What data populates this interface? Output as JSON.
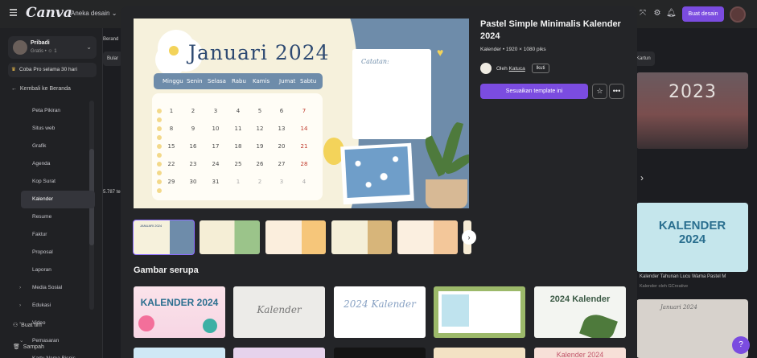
{
  "topbar": {
    "logo": "Canva",
    "menu": "Aneka desain",
    "create_button": "Buat desain"
  },
  "sidebar": {
    "account_name": "Pribadi",
    "account_sub": "Gratis • ☺ 1",
    "pro_label": "Coba Pro selama 30 hari",
    "back_label": "Kembali ke Beranda",
    "items": [
      {
        "label": "Peta Pikiran"
      },
      {
        "label": "Situs web"
      },
      {
        "label": "Grafik"
      },
      {
        "label": "Agenda"
      },
      {
        "label": "Kop Surat"
      },
      {
        "label": "Kalender"
      },
      {
        "label": "Resume"
      },
      {
        "label": "Faktur"
      },
      {
        "label": "Proposal"
      },
      {
        "label": "Laporan"
      },
      {
        "label": "Media Sosial"
      },
      {
        "label": "Edukasi"
      },
      {
        "label": "Video"
      },
      {
        "label": "Pemasaran"
      },
      {
        "label": "Kartu Nama Bisnis"
      }
    ],
    "create_team": "Buat tim",
    "trash": "Sampah"
  },
  "background": {
    "breadcrumb": "Berand",
    "tab_left": "Bular",
    "tab_right": "Kartun",
    "left_count": "5.787 te",
    "right_year": "2023",
    "right_card_title": "KALENDER 2024",
    "right_caption": "Kalender Tahunan Lucu Warna Pastel M",
    "right_caption_sub": "Kalender oleh GCreative",
    "card3_title": "Januari 2024"
  },
  "modal": {
    "title": "Pastel Simple Minimalis Kalender 2024",
    "meta": "Kalender • 1920 × 1080 piks",
    "author_prefix": "Oleh",
    "author": "Katuca",
    "follow": "Ikuti",
    "use_button": "Sesuaikan template ini",
    "similar_title": "Gambar serupa"
  },
  "preview": {
    "month": "Januari 2024",
    "days": [
      "Minggu",
      "Senin",
      "Selasa",
      "Rabu",
      "Kamis",
      "Jumat",
      "Sabtu"
    ],
    "notes_label": "Catatan:",
    "weeks": [
      [
        "1",
        "2",
        "3",
        "4",
        "5",
        "6",
        "7"
      ],
      [
        "8",
        "9",
        "10",
        "11",
        "12",
        "13",
        "14"
      ],
      [
        "15",
        "16",
        "17",
        "18",
        "19",
        "20",
        "21"
      ],
      [
        "22",
        "23",
        "24",
        "25",
        "26",
        "27",
        "28"
      ],
      [
        "29",
        "30",
        "31",
        "1",
        "2",
        "3",
        "4"
      ]
    ]
  },
  "thumbs_month": "JANUARI 2024",
  "similar": [
    {
      "title": "KALENDER 2024"
    },
    {
      "title": "Kalender"
    },
    {
      "title": "2024 Kalender"
    },
    {
      "title": ""
    },
    {
      "title": "2024 Kalender"
    }
  ],
  "similar_row2": [
    {
      "title": ""
    },
    {
      "title": ""
    },
    {
      "title": ""
    },
    {
      "title": ""
    },
    {
      "title": "Kalender 2024"
    }
  ]
}
